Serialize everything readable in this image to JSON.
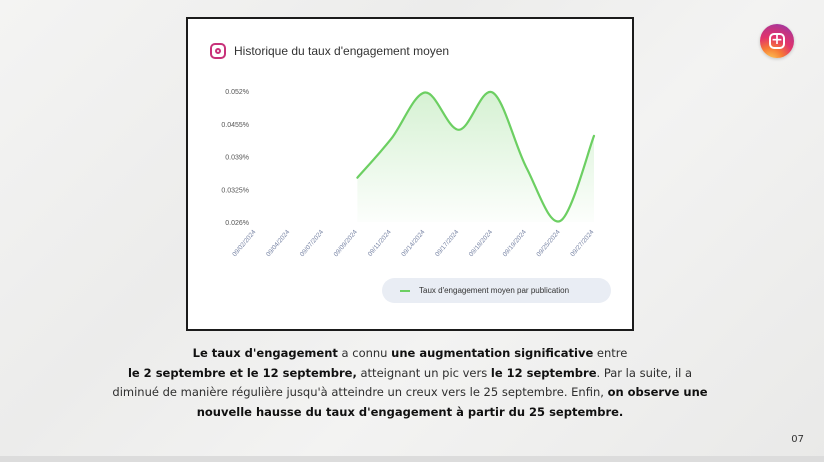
{
  "chart": {
    "title": "Historique du taux d'engagement moyen",
    "legend_label": "Taux d'engagement moyen par publication",
    "line_color": "#6ccf62",
    "icon": "instagram-icon"
  },
  "chart_data": {
    "type": "line",
    "title": "Historique du taux d'engagement moyen",
    "xlabel": "",
    "ylabel": "",
    "y_ticks": [
      "0.052%",
      "0.0455%",
      "0.039%",
      "0.0325%",
      "0.026%"
    ],
    "y_tick_values": [
      0.052,
      0.0455,
      0.039,
      0.0325,
      0.026
    ],
    "ylim": [
      0.026,
      0.052
    ],
    "categories": [
      "09/02/2024",
      "09/04/2024",
      "09/07/2024",
      "09/09/2024",
      "09/11/2024",
      "09/14/2024",
      "09/17/2024",
      "09/18/2024",
      "09/19/2024",
      "09/25/2024",
      "09/27/2024"
    ],
    "series": [
      {
        "name": "Taux d'engagement moyen par publication",
        "values": [
          null,
          null,
          null,
          0.0348,
          0.0425,
          0.0517,
          0.0443,
          0.0517,
          0.0368,
          0.0262,
          0.0431
        ]
      }
    ],
    "grid": false,
    "legend": "bottom-right"
  },
  "caption": {
    "p1": "Le taux d'engagement",
    "p2": " a connu ",
    "p3": "une augmentation significative",
    "p4": " entre ",
    "p5": "le 2 septembre et le 12 septembre,",
    "p6": " atteignant un pic vers ",
    "p7": "le 12 septembre",
    "p8": ". Par la suite, il a diminué de manière régulière jusqu'à atteindre un creux vers le 25 septembre. Enfin, ",
    "p9": "on observe une nouvelle hausse du taux d'engagement à partir du 25 septembre."
  },
  "page_number": "07",
  "insta_button": {
    "icon": "add-post-icon",
    "glyph": "+"
  }
}
